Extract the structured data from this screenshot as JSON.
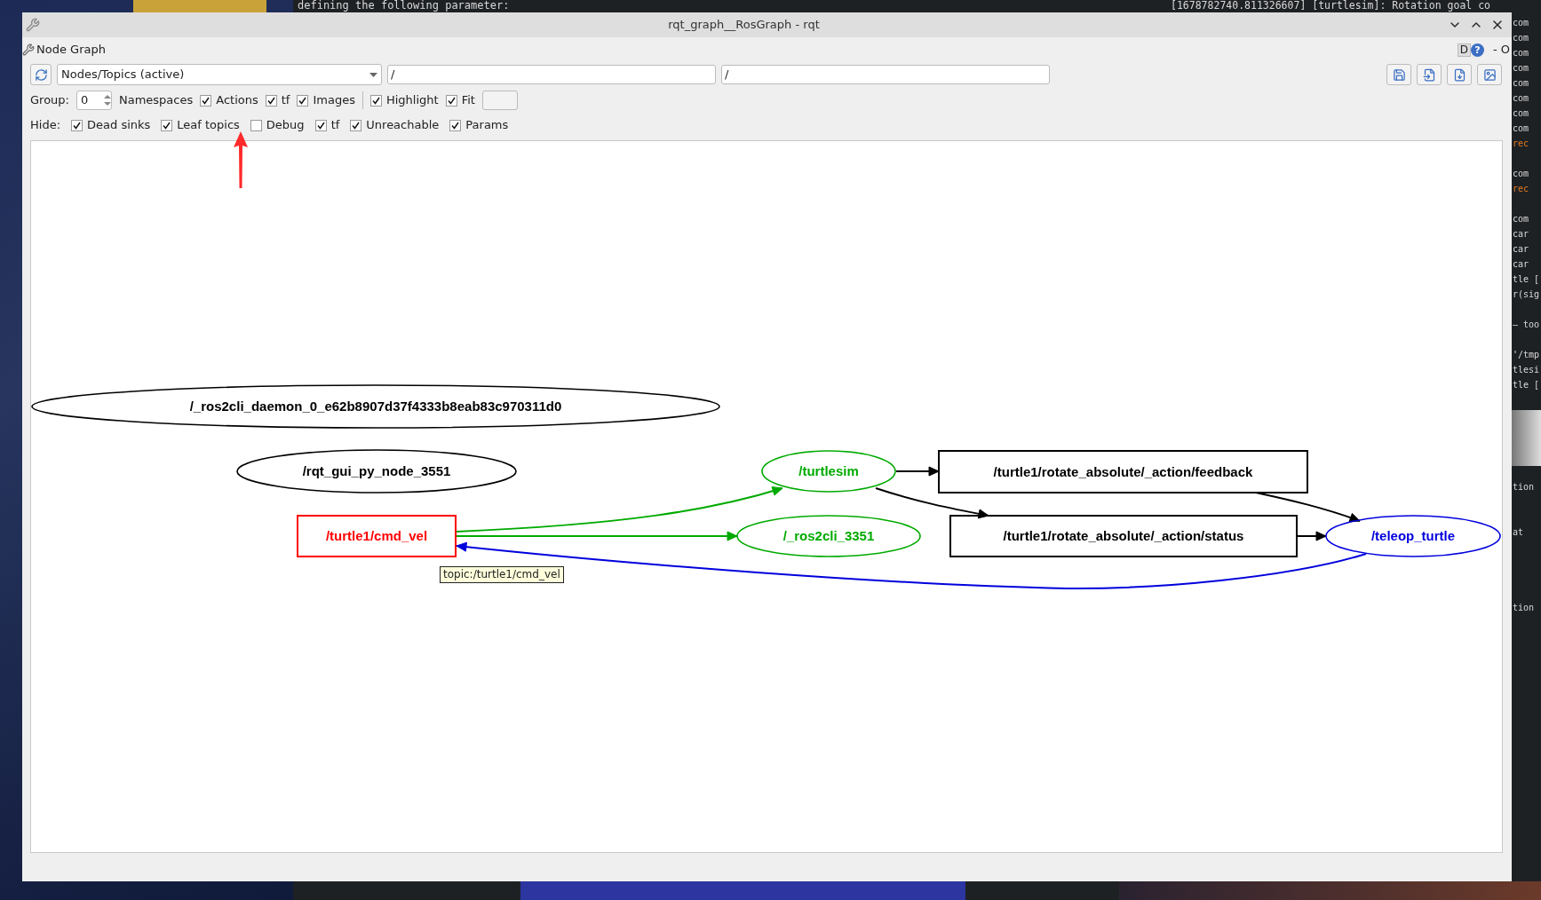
{
  "terminal_top": [
    "defining the following parameter:",
    "[1678782740.811326607] [turtlesim]: Rotation goal co"
  ],
  "terminal_right": [
    {
      "kind": "text",
      "text": "com"
    },
    {
      "kind": "text",
      "text": "com"
    },
    {
      "kind": "text",
      "text": "com"
    },
    {
      "kind": "text",
      "text": "com"
    },
    {
      "kind": "text",
      "text": "com"
    },
    {
      "kind": "text",
      "text": "com"
    },
    {
      "kind": "text",
      "text": "com"
    },
    {
      "kind": "text",
      "text": "com"
    },
    {
      "kind": "warn",
      "text": "rec"
    },
    {
      "kind": "gap"
    },
    {
      "kind": "text",
      "text": "com"
    },
    {
      "kind": "warn",
      "text": "rec"
    },
    {
      "kind": "gap"
    },
    {
      "kind": "text",
      "text": "com"
    },
    {
      "kind": "text",
      "text": "car"
    },
    {
      "kind": "text",
      "text": "car"
    },
    {
      "kind": "text",
      "text": "car"
    },
    {
      "kind": "text",
      "text": "tle ["
    },
    {
      "kind": "text",
      "text": "r(sig"
    },
    {
      "kind": "gap"
    },
    {
      "kind": "text",
      "text": "— too"
    },
    {
      "kind": "gap"
    },
    {
      "kind": "text",
      "text": "'/tmp"
    },
    {
      "kind": "text",
      "text": "tlesi"
    },
    {
      "kind": "text",
      "text": "tle ["
    }
  ],
  "terminal_right_lower": [
    {
      "kind": "text",
      "text": "tion"
    },
    {
      "kind": "gap"
    },
    {
      "kind": "gap"
    },
    {
      "kind": "text",
      "text": "at"
    },
    {
      "kind": "gap"
    },
    {
      "kind": "gap"
    },
    {
      "kind": "gap"
    },
    {
      "kind": "gap"
    },
    {
      "kind": "text",
      "text": "tion"
    }
  ],
  "window": {
    "title": "rqt_graph__RosGraph - rqt"
  },
  "plugin": {
    "title": "Node Graph",
    "help_d": "D",
    "help_q": "?",
    "controls": "- O"
  },
  "toolbar": {
    "mode": "Nodes/Topics (active)",
    "filter_1": "/",
    "filter_2": "/"
  },
  "group": {
    "label": "Group:",
    "value": "0",
    "namespaces": "Namespaces",
    "options": [
      {
        "label": "Actions",
        "checked": true
      },
      {
        "label": "tf",
        "checked": true
      },
      {
        "label": "Images",
        "checked": true
      }
    ],
    "options_2": [
      {
        "label": "Highlight",
        "checked": true
      },
      {
        "label": "Fit",
        "checked": true
      }
    ]
  },
  "hide": {
    "label": "Hide:",
    "options": [
      {
        "label": "Dead sinks",
        "checked": true
      },
      {
        "label": "Leaf topics",
        "checked": true
      },
      {
        "label": "Debug",
        "checked": false
      },
      {
        "label": "tf",
        "checked": true
      },
      {
        "label": "Unreachable",
        "checked": true
      },
      {
        "label": "Params",
        "checked": true
      }
    ]
  },
  "graph": {
    "nodes": [
      {
        "kind": "ellipse",
        "label": "/_ros2cli_daemon_0_e62b8907d37f4333b8eab83c970311d0",
        "color": "#000000"
      },
      {
        "kind": "ellipse",
        "label": "/rqt_gui_py_node_3551",
        "color": "#000000"
      },
      {
        "kind": "box",
        "label": "/turtle1/cmd_vel",
        "color": "#ff0000"
      },
      {
        "kind": "ellipse",
        "label": "/turtlesim",
        "color": "#00aa00"
      },
      {
        "kind": "ellipse",
        "label": "/_ros2cli_3351",
        "color": "#00aa00"
      },
      {
        "kind": "box",
        "label": "/turtle1/rotate_absolute/_action/feedback",
        "color": "#000000"
      },
      {
        "kind": "box",
        "label": "/turtle1/rotate_absolute/_action/status",
        "color": "#000000"
      },
      {
        "kind": "ellipse",
        "label": "/teleop_turtle",
        "color": "#0000dd"
      }
    ],
    "edges": [
      {
        "color": "#00aa00"
      },
      {
        "color": "#00aa00"
      },
      {
        "color": "#000000"
      },
      {
        "color": "#000000"
      },
      {
        "color": "#000000"
      },
      {
        "color": "#000000"
      },
      {
        "color": "#0000dd"
      }
    ],
    "tooltip": "topic:/turtle1/cmd_vel"
  }
}
